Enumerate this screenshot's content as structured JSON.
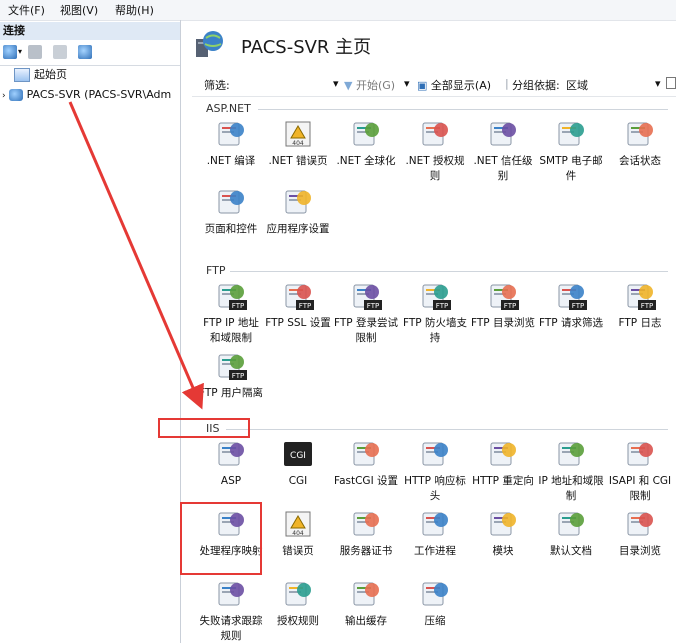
{
  "menubar": {
    "items": [
      "文件(F)",
      "视图(V)",
      "帮助(H)"
    ]
  },
  "connections": {
    "header": "连接",
    "tree": [
      {
        "label": "起始页"
      },
      {
        "label": "PACS-SVR (PACS-SVR\\Adm"
      }
    ]
  },
  "main": {
    "title": "PACS-SVR 主页",
    "filterbar": {
      "filter_label": "筛选:",
      "start_label": "开始(G)",
      "show_all_label": "全部显示(A)",
      "group_by_label": "分组依据:",
      "group_by_value": "区域"
    },
    "groups": [
      {
        "name": "ASP.NET",
        "items": [
          {
            "label": ".NET 编译",
            "icon": "net-compile-icon"
          },
          {
            "label": ".NET 错误页",
            "icon": "net-error-pages-icon"
          },
          {
            "label": ".NET 全球化",
            "icon": "net-globalization-icon"
          },
          {
            "label": ".NET 授权规则",
            "icon": "net-authorization-icon"
          },
          {
            "label": ".NET 信任级别",
            "icon": "net-trust-levels-icon"
          },
          {
            "label": "SMTP 电子邮件",
            "icon": "smtp-email-icon"
          },
          {
            "label": "会话状态",
            "icon": "session-state-icon"
          },
          {
            "label": "页面和控件",
            "icon": "pages-controls-icon"
          },
          {
            "label": "应用程序设置",
            "icon": "app-settings-icon"
          }
        ]
      },
      {
        "name": "FTP",
        "items": [
          {
            "label": "FTP IP 地址和域限制",
            "icon": "ftp-ip-restrictions-icon"
          },
          {
            "label": "FTP SSL 设置",
            "icon": "ftp-ssl-icon"
          },
          {
            "label": "FTP 登录尝试限制",
            "icon": "ftp-logon-attempts-icon"
          },
          {
            "label": "FTP 防火墙支持",
            "icon": "ftp-firewall-icon"
          },
          {
            "label": "FTP 目录浏览",
            "icon": "ftp-directory-browsing-icon"
          },
          {
            "label": "FTP 请求筛选",
            "icon": "ftp-request-filtering-icon"
          },
          {
            "label": "FTP 日志",
            "icon": "ftp-logging-icon"
          },
          {
            "label": "FTP 用户隔离",
            "icon": "ftp-user-isolation-icon"
          }
        ]
      },
      {
        "name": "IIS",
        "items": [
          {
            "label": "ASP",
            "icon": "asp-icon"
          },
          {
            "label": "CGI",
            "icon": "cgi-icon"
          },
          {
            "label": "FastCGI 设置",
            "icon": "fastcgi-icon"
          },
          {
            "label": "HTTP 响应标头",
            "icon": "http-response-headers-icon"
          },
          {
            "label": "HTTP 重定向",
            "icon": "http-redirect-icon"
          },
          {
            "label": "IP 地址和域限制",
            "icon": "ip-domain-restrictions-icon"
          },
          {
            "label": "ISAPI 和 CGI 限制",
            "icon": "isapi-cgi-restrictions-icon"
          },
          {
            "label": "处理程序映射",
            "icon": "handler-mappings-icon"
          },
          {
            "label": "错误页",
            "icon": "error-pages-icon"
          },
          {
            "label": "服务器证书",
            "icon": "server-certificates-icon"
          },
          {
            "label": "工作进程",
            "icon": "worker-processes-icon"
          },
          {
            "label": "模块",
            "icon": "modules-icon"
          },
          {
            "label": "默认文档",
            "icon": "default-document-icon"
          },
          {
            "label": "目录浏览",
            "icon": "directory-browsing-icon"
          },
          {
            "label": "失败请求跟踪规则",
            "icon": "failed-request-tracing-icon"
          },
          {
            "label": "授权规则",
            "icon": "authorization-rules-icon"
          },
          {
            "label": "输出缓存",
            "icon": "output-caching-icon"
          },
          {
            "label": "压缩",
            "icon": "compression-icon"
          }
        ]
      }
    ]
  },
  "colors": {
    "annotation_red": "#e53935",
    "accent_blue": "#2f6fb7"
  }
}
